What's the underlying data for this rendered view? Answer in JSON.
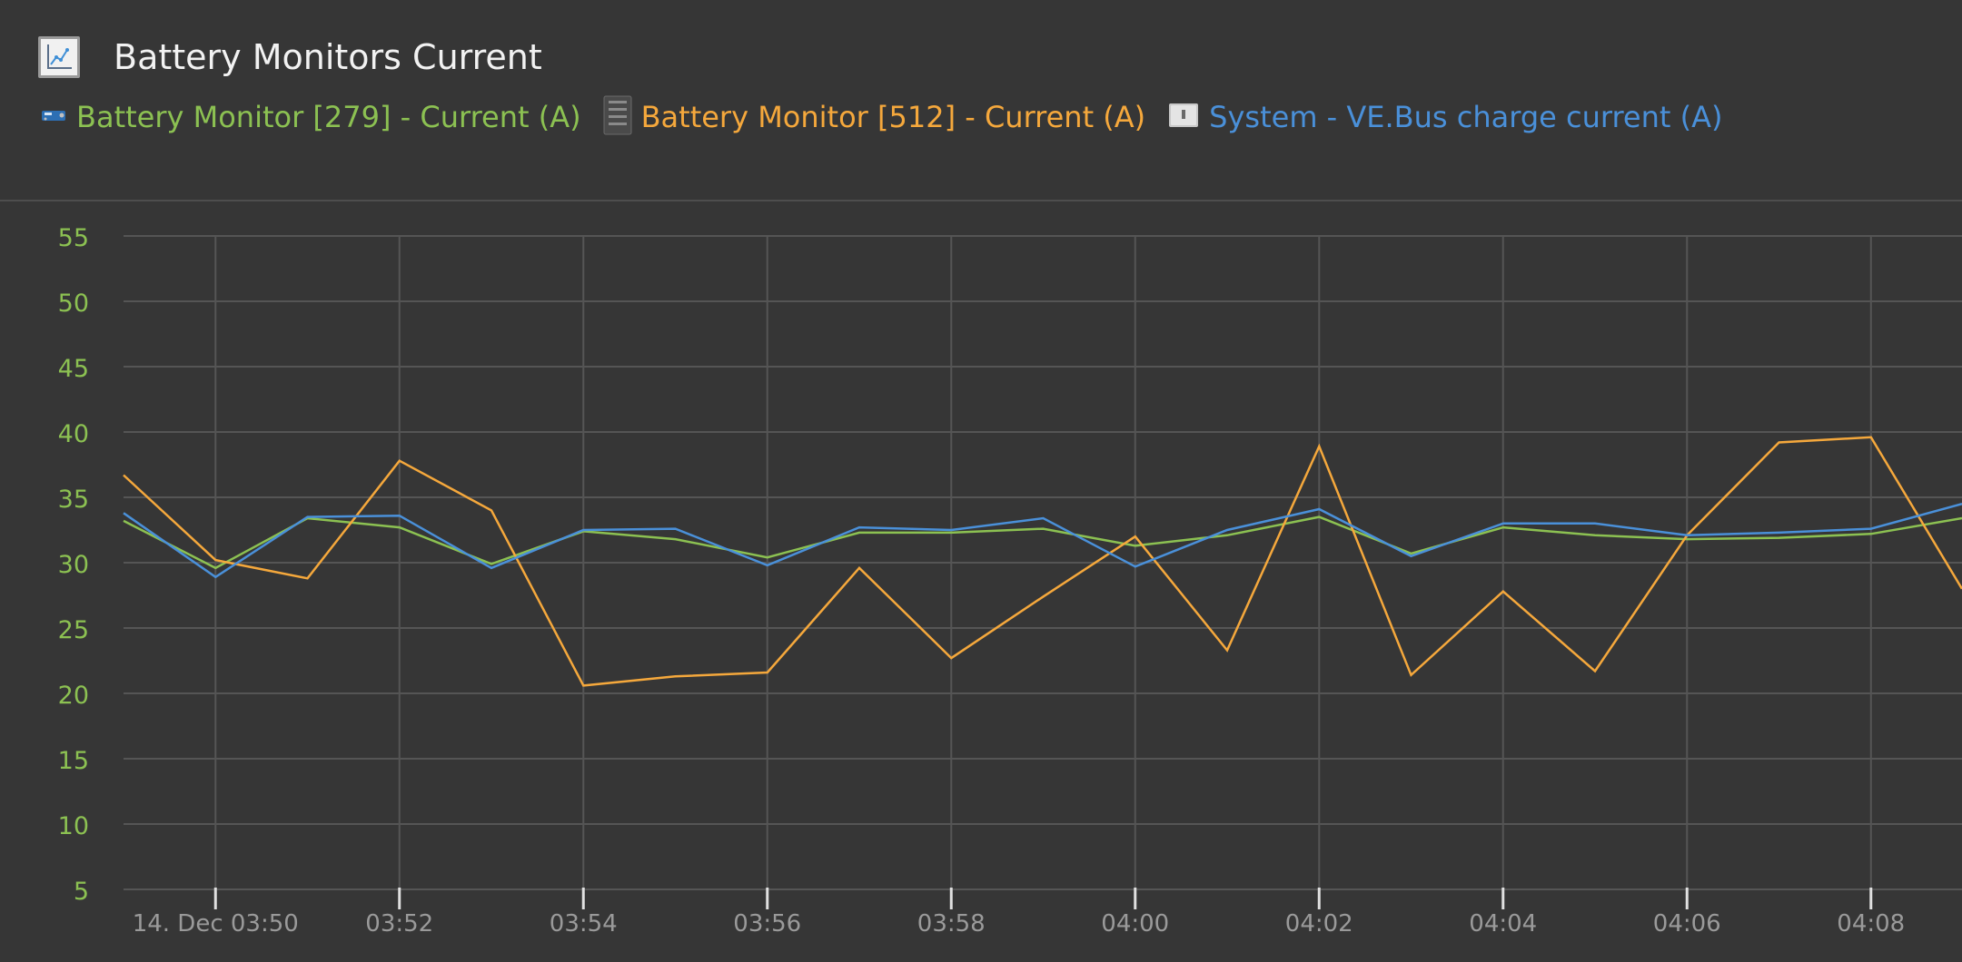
{
  "header": {
    "title": "Battery Monitors Current",
    "chart_icon": "line-chart-icon"
  },
  "legend": [
    {
      "label": "Battery Monitor [279] - Current (A)",
      "color": "#8cc152",
      "icon": "smart-shunt-icon"
    },
    {
      "label": "Battery Monitor [512] - Current (A)",
      "color": "#f5a83c",
      "icon": "lynx-bms-icon"
    },
    {
      "label": "System - VE.Bus charge current (A)",
      "color": "#4a90d9",
      "icon": "system-device-icon"
    }
  ],
  "colors": {
    "background": "#363636",
    "grid": "#555555",
    "y_tick_text": "#8cc152",
    "x_tick_text": "#9a9a9a"
  },
  "chart_data": {
    "type": "line",
    "title": "Battery Monitors Current",
    "x_tick_labels": [
      "14. Dec 03:50",
      "03:52",
      "03:54",
      "03:56",
      "03:58",
      "04:00",
      "04:02",
      "04:04",
      "04:06",
      "04:08"
    ],
    "x_ticks_minutes": [
      0,
      2,
      4,
      6,
      8,
      10,
      12,
      14,
      16,
      18
    ],
    "x_unit": "minutes after 14. Dec 03:50",
    "xlim": [
      -1,
      18.99
    ],
    "ylim": [
      5,
      55
    ],
    "y_ticks": [
      5,
      10,
      15,
      20,
      25,
      30,
      35,
      40,
      45,
      50,
      55
    ],
    "grid": true,
    "legend_placement": "top",
    "series": [
      {
        "name": "Battery Monitor [279] - Current (A)",
        "color": "#8cc152",
        "x": [
          -1,
          0,
          1,
          2,
          3,
          4,
          5,
          6,
          7,
          8,
          9,
          10,
          11,
          12,
          13,
          14,
          15,
          16,
          17,
          18,
          18.99
        ],
        "y": [
          33.2,
          29.6,
          33.4,
          32.7,
          29.9,
          32.4,
          31.8,
          30.4,
          32.3,
          32.3,
          32.6,
          31.3,
          32.1,
          33.5,
          30.7,
          32.7,
          32.1,
          31.8,
          31.9,
          32.2,
          33.4
        ]
      },
      {
        "name": "Battery Monitor [512] - Current (A)",
        "color": "#f5a83c",
        "x": [
          -1,
          0,
          1,
          2,
          3,
          4,
          5,
          6,
          7,
          8,
          9,
          10,
          11,
          12,
          13,
          14,
          15,
          16,
          17,
          18,
          18.99
        ],
        "y": [
          36.7,
          30.2,
          28.8,
          37.8,
          34.0,
          20.6,
          21.3,
          21.6,
          29.6,
          22.7,
          27.4,
          32.0,
          23.3,
          38.9,
          21.4,
          27.8,
          21.7,
          32.1,
          39.2,
          39.6,
          28.0
        ]
      },
      {
        "name": "System - VE.Bus charge current (A)",
        "color": "#4a90d9",
        "x": [
          -1,
          0,
          1,
          2,
          3,
          4,
          5,
          6,
          7,
          8,
          9,
          10,
          11,
          12,
          13,
          14,
          15,
          16,
          17,
          18,
          18.99
        ],
        "y": [
          33.8,
          28.9,
          33.5,
          33.6,
          29.6,
          32.5,
          32.6,
          29.8,
          32.7,
          32.5,
          33.4,
          29.7,
          32.5,
          34.1,
          30.5,
          33.0,
          33.0,
          32.1,
          32.3,
          32.6,
          34.5
        ]
      }
    ]
  }
}
